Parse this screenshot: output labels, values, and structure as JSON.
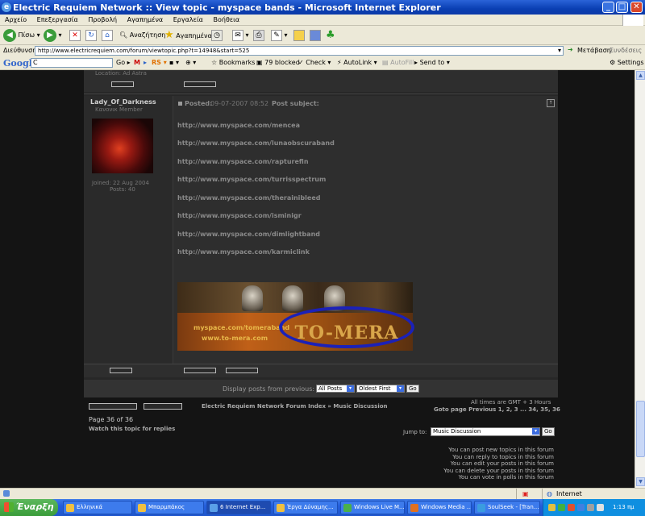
{
  "window": {
    "title": "Electric Requiem Network :: View topic - myspace bands - Microsoft Internet Explorer",
    "minimize": "_",
    "maximize": "□",
    "close": "✕"
  },
  "menu": [
    "Αρχείο",
    "Επεξεργασία",
    "Προβολή",
    "Αγαπημένα",
    "Εργαλεία",
    "Βοήθεια"
  ],
  "toolbar": {
    "back": "Πίσω",
    "search": "Αναζήτηση",
    "favorites": "Αγαπημένα"
  },
  "address": {
    "label": "Διεύθυνση",
    "url": "http://www.electricrequiem.com/forum/viewtopic.php?t=14948&start=525",
    "go": "Μετάβαση",
    "links": "Συνδέσεις"
  },
  "googlebar": {
    "logo": "Google",
    "query": "C",
    "go": "Go",
    "bookmarks": "Bookmarks",
    "blocked": "79 blocked",
    "check": "Check",
    "autolink": "AutoLink",
    "autofill": "AutoFill",
    "sendto": "Send to",
    "settings": "Settings"
  },
  "prevpost": {
    "location": "Location: Ad Astra"
  },
  "post": {
    "author": "Lady_Of_Darkness",
    "rank": "Κανονικ Member",
    "joined": "Joined: 22 Aug 2004",
    "posts": "Posts: 40",
    "posted_label": "Posted:",
    "posted_date": "09-07-2007 08:52",
    "subject_label": "Post subject:",
    "links": [
      "http://www.myspace.com/mencea",
      "http://www.myspace.com/lunaobscuraband",
      "http://www.myspace.com/rapturefin",
      "http://www.myspace.com/turrisspectrum",
      "http://www.myspace.com/therainibleed",
      "http://www.myspace.com/isminigr",
      "http://www.myspace.com/dimlightband",
      "http://www.myspace.com/karmiclink"
    ],
    "banner_url1": "myspace.com/tomeraband",
    "banner_url2": "www.to-mera.com",
    "banner_logo": "TO-MERA"
  },
  "display": {
    "label": "Display posts from previous:",
    "sel1": "All Posts",
    "sel2": "Oldest First",
    "go": "Go"
  },
  "footer": {
    "breadcrumb": "Electric Requiem Network Forum Index » Music Discussion",
    "times": "All times are GMT + 3 Hours",
    "goto": "Goto page Previous  1, 2, 3 ... 34, 35, 36",
    "page": "Page 36 of 36",
    "watch": "Watch this topic for replies",
    "jumpto_label": "Jump to:",
    "jumpto_value": "Music Discussion",
    "jumpto_go": "Go",
    "perms": [
      "You can post new topics in this forum",
      "You can reply to topics in this forum",
      "You can edit your posts in this forum",
      "You can delete your posts in this forum",
      "You can vote in polls in this forum"
    ]
  },
  "status": {
    "zone": "Internet"
  },
  "taskbar": {
    "start": "Έναρξη",
    "items": [
      "Ελληνικά",
      "Μπαρμπάκος",
      "6 Internet Exp...",
      "Έργα Δύναμης...",
      "Windows Live M...",
      "Windows Media ...",
      "SoulSeek - [Tran..."
    ],
    "clock": "1:13 πμ"
  }
}
